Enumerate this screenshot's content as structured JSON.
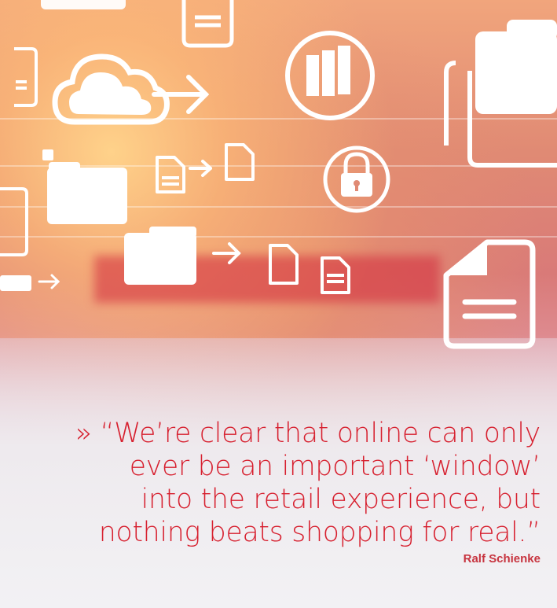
{
  "quote": {
    "marker": "»",
    "lines": [
      "“We’re clear that online can only",
      "ever be an important ‘window’",
      "into the retail experience, but",
      "nothing beats shopping for real.”"
    ],
    "author": "Ralf Schienke"
  },
  "colors": {
    "accent": "#d7202f",
    "icon": "#ffffff"
  },
  "icons": [
    "document-icon",
    "cloud-icon",
    "arrow-right-icon",
    "server-icon",
    "folder-icon",
    "file-icon",
    "lock-icon",
    "file-transfer-icon"
  ]
}
